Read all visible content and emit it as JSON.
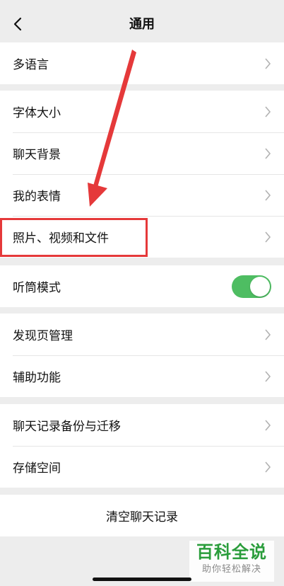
{
  "nav": {
    "title": "通用",
    "back_icon": "chevron-left-icon"
  },
  "groups": [
    {
      "items": [
        {
          "label": "多语言"
        }
      ]
    },
    {
      "items": [
        {
          "label": "字体大小"
        },
        {
          "label": "聊天背景"
        },
        {
          "label": "我的表情"
        },
        {
          "label": "照片、视频和文件"
        }
      ]
    },
    {
      "items": [
        {
          "label": "听筒模式",
          "toggle_on": true
        }
      ]
    },
    {
      "items": [
        {
          "label": "发现页管理"
        },
        {
          "label": "辅助功能"
        }
      ]
    },
    {
      "items": [
        {
          "label": "聊天记录备份与迁移"
        },
        {
          "label": "存储空间"
        }
      ]
    },
    {
      "items": [
        {
          "label": "清空聊天记录"
        }
      ]
    }
  ],
  "annotation": {
    "color": "#e5393a"
  },
  "watermark": {
    "title": "百科全说",
    "subtitle": "助你轻松解决",
    "color": "#2a9d3b"
  },
  "colors": {
    "toggle_on": "#4ebd62",
    "background": "#ededed"
  }
}
